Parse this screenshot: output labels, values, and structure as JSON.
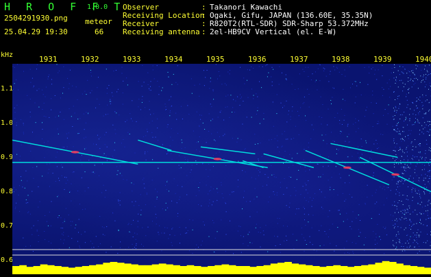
{
  "header": {
    "title": "H R O F F T",
    "version": "1.0.0",
    "file_name": "2504291930.png",
    "meteor_label": "meteor",
    "date_time": "25.04.29 19:30",
    "meteor_count": "66"
  },
  "info": [
    {
      "label": "Observer",
      "value": "Takanori Kawachi"
    },
    {
      "label": "Receiving Location",
      "value": "Ogaki, Gifu, JAPAN (136.60E, 35.35N)"
    },
    {
      "label": "Receiver",
      "value": "R820T2(RTL-SDR) SDR-Sharp 53.372MHz"
    },
    {
      "label": "Receiving antenna",
      "value": "2el-HB9CV Vertical (el. E-W)"
    }
  ],
  "separator": ":",
  "axis": {
    "unit": "kHz",
    "minutes": [
      "1931",
      "1932",
      "1933",
      "1934",
      "1935",
      "1936",
      "1937",
      "1938",
      "1939",
      "1940"
    ],
    "freq_labels": [
      "1.1",
      "1.0",
      "0.9",
      "0.8",
      "0.7",
      "0.6"
    ]
  },
  "spectrogram": {
    "background_color": "#0a1470",
    "carrier_freq_khz": 0.885,
    "signal_color": "#00dddd",
    "hot_color": "#ff3355",
    "band_color": "#ffff00",
    "meteor_traces": [
      {
        "t0": 0.0,
        "f0": 0.95,
        "t1": 0.3,
        "f1": 0.88,
        "hot": true
      },
      {
        "t0": 0.3,
        "f0": 0.95,
        "t1": 0.38,
        "f1": 0.92,
        "hot": false
      },
      {
        "t0": 0.37,
        "f0": 0.92,
        "t1": 0.61,
        "f1": 0.87,
        "hot": true
      },
      {
        "t0": 0.45,
        "f0": 0.93,
        "t1": 0.58,
        "f1": 0.91,
        "hot": false
      },
      {
        "t0": 0.6,
        "f0": 0.91,
        "t1": 0.72,
        "f1": 0.87,
        "hot": false
      },
      {
        "t0": 0.7,
        "f0": 0.92,
        "t1": 0.9,
        "f1": 0.82,
        "hot": true
      },
      {
        "t0": 0.76,
        "f0": 0.94,
        "t1": 0.92,
        "f1": 0.9,
        "hot": false
      },
      {
        "t0": 0.83,
        "f0": 0.9,
        "t1": 1.0,
        "f1": 0.8,
        "hot": true
      },
      {
        "t0": 0.55,
        "f0": 0.89,
        "t1": 0.6,
        "f1": 0.87,
        "hot": false
      }
    ],
    "band_profile": [
      0.5,
      0.6,
      0.4,
      0.5,
      0.7,
      0.6,
      0.5,
      0.4,
      0.3,
      0.4,
      0.5,
      0.6,
      0.7,
      0.9,
      1.0,
      0.9,
      0.8,
      0.7,
      0.6,
      0.6,
      0.7,
      0.8,
      0.7,
      0.6,
      0.5,
      0.6,
      0.5,
      0.4,
      0.5,
      0.6,
      0.7,
      0.6,
      0.5,
      0.5,
      0.4,
      0.5,
      0.6,
      0.8,
      0.9,
      1.0,
      0.8,
      0.7,
      0.6,
      0.5,
      0.4,
      0.5,
      0.6,
      0.5,
      0.4,
      0.5,
      0.6,
      0.7,
      0.9,
      1.1,
      1.0,
      0.8,
      0.6,
      0.5,
      0.4,
      0.3
    ]
  }
}
